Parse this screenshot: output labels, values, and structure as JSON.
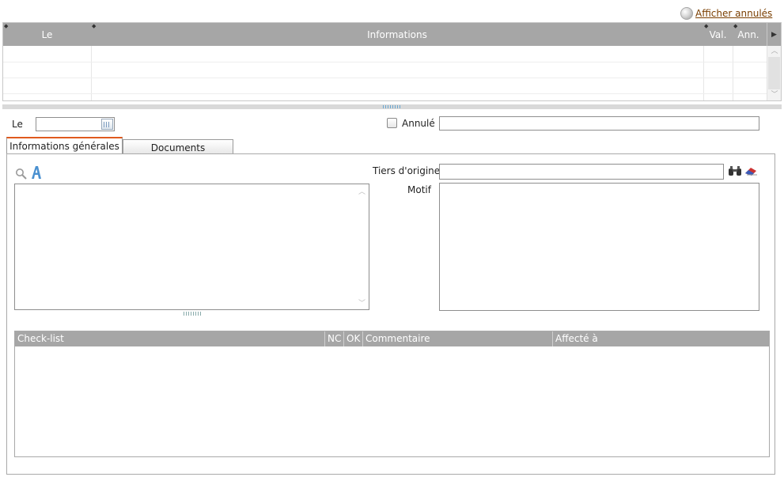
{
  "top": {
    "show_cancelled_label": "Afficher annulés"
  },
  "history_grid": {
    "columns": [
      "Le",
      "Informations",
      "Val.",
      "Ann."
    ],
    "rows": []
  },
  "form": {
    "le_label": "Le",
    "le_value": "",
    "annule_label": "Annulé",
    "annule_checked": false,
    "annule_value": ""
  },
  "tabs": [
    {
      "label": "Informations générales",
      "active": true
    },
    {
      "label": "Documents",
      "active": false
    }
  ],
  "general": {
    "tiers_label": "Tiers d'origine",
    "tiers_value": "",
    "motif_label": "Motif",
    "motif_value": "",
    "notes_value": ""
  },
  "checklist": {
    "columns": [
      "Check-list",
      "NC",
      "OK",
      "Commentaire",
      "Affecté à"
    ],
    "rows": []
  },
  "colors": {
    "header_bg": "#a6a6a6",
    "active_tab_accent": "#e05a1e",
    "link": "#7a3e00"
  }
}
